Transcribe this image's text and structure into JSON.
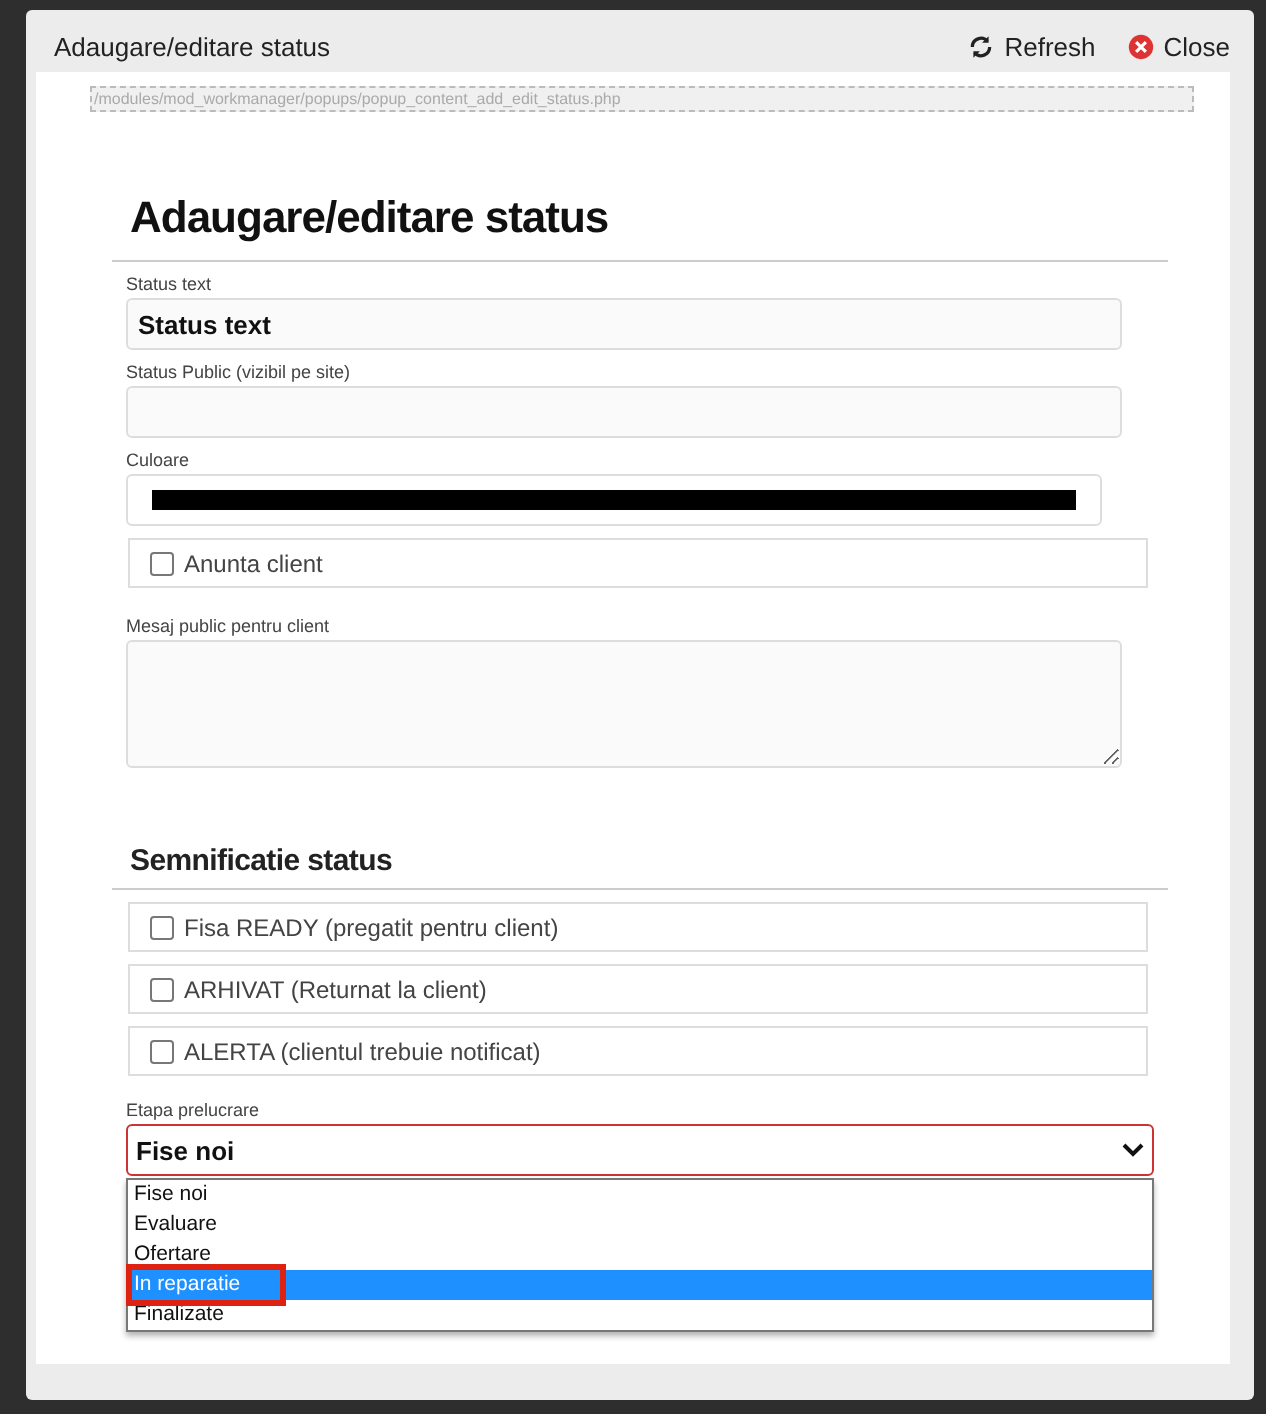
{
  "window": {
    "title": "Adaugare/editare status",
    "actions": [
      {
        "kind": "refresh",
        "label": "Refresh"
      },
      {
        "kind": "close",
        "label": "Close"
      }
    ]
  },
  "path": "/modules/mod_workmanager/popups/popup_content_add_edit_status.php",
  "heading": "Adaugare/editare status",
  "fields": [
    {
      "kind": "text",
      "label": "Status text",
      "value": "Status text"
    },
    {
      "kind": "text",
      "label": "Status Public (vizibil pe site)"
    },
    {
      "kind": "color",
      "label": "Culoare",
      "color": "#000000"
    },
    {
      "kind": "checkbox",
      "label": "Anunta client",
      "checked": false
    },
    {
      "kind": "textarea",
      "label": "Mesaj public pentru client"
    }
  ],
  "section": {
    "title": "Semnificatie status",
    "checkboxes": [
      {
        "label": "Fisa READY (pregatit pentru client)",
        "checked": false
      },
      {
        "label": "ARHIVAT (Returnat la client)",
        "checked": false
      },
      {
        "label": "ALERTA (clientul trebuie notificat)",
        "checked": false
      }
    ]
  },
  "stage": {
    "label": "Etapa prelucrare",
    "value": "Fise noi",
    "expanded": true,
    "options": [
      {
        "label": "Fise noi",
        "highlighted": false,
        "marked": false
      },
      {
        "label": "Evaluare",
        "highlighted": false,
        "marked": false
      },
      {
        "label": "Ofertare",
        "highlighted": false,
        "marked": false
      },
      {
        "label": "In reparatie",
        "highlighted": true,
        "marked": true
      },
      {
        "label": "Finalizate",
        "highlighted": false,
        "marked": false
      }
    ]
  }
}
